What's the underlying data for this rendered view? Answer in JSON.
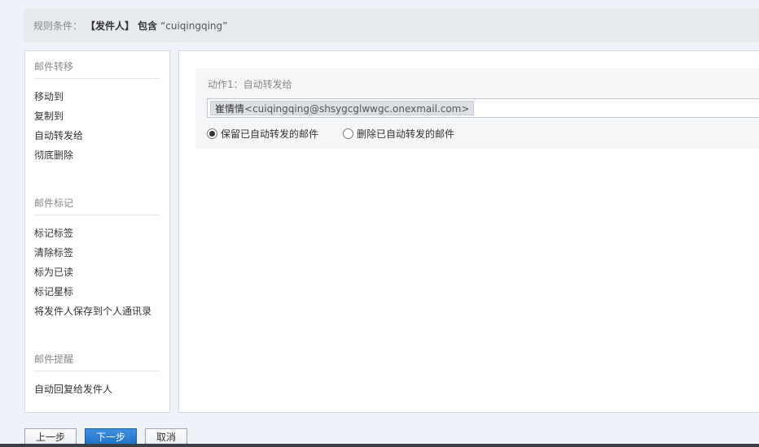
{
  "rule": {
    "label": "规则条件：",
    "field": "【发件人】",
    "operator": "包含",
    "value": "“cuiqingqing”"
  },
  "sidebar": {
    "groups": [
      {
        "title": "邮件转移",
        "items": [
          "移动到",
          "复制到",
          "自动转发给",
          "彻底删除"
        ]
      },
      {
        "title": "邮件标记",
        "items": [
          "标记标签",
          "清除标签",
          "标为已读",
          "标记星标",
          "将发件人保存到个人通讯录"
        ]
      },
      {
        "title": "邮件提醒",
        "items": [
          "自动回复给发件人"
        ]
      }
    ]
  },
  "action": {
    "title": "动作1：自动转发给",
    "recipient_name": "崔情情",
    "recipient_email": "<cuiqingqing@shsygcglwwgc.onexmail.com>",
    "options": [
      {
        "label": "保留已自动转发的邮件",
        "checked": true
      },
      {
        "label": "删除已自动转发的邮件",
        "checked": false
      }
    ]
  },
  "buttons": {
    "prev": "上一步",
    "next": "下一步",
    "cancel": "取消"
  }
}
